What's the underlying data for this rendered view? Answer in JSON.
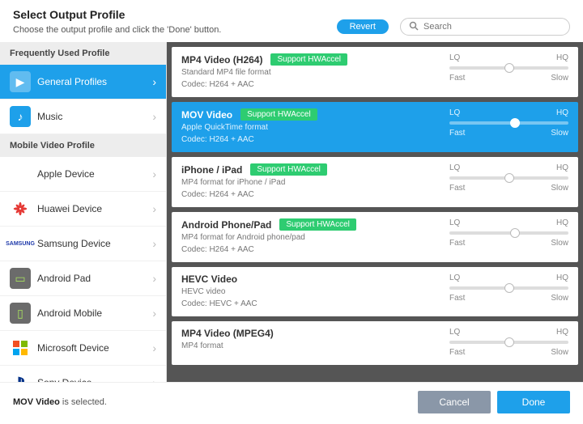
{
  "header": {
    "title": "Select Output Profile",
    "subtitle": "Choose the output profile and click the 'Done' button.",
    "revert": "Revert",
    "search_placeholder": "Search"
  },
  "sidebar": {
    "groups": [
      {
        "header": "Frequently Used Profile",
        "items": [
          {
            "label": "General Profiles",
            "icon": "play",
            "selected": true
          },
          {
            "label": "Music",
            "icon": "music"
          }
        ]
      },
      {
        "header": "Mobile Video Profile",
        "items": [
          {
            "label": "Apple Device",
            "icon": "apple"
          },
          {
            "label": "Huawei Device",
            "icon": "huawei"
          },
          {
            "label": "Samsung Device",
            "icon": "samsung"
          },
          {
            "label": "Android Pad",
            "icon": "tablet"
          },
          {
            "label": "Android Mobile",
            "icon": "phone"
          },
          {
            "label": "Microsoft Device",
            "icon": "ms"
          },
          {
            "label": "Sony Device",
            "icon": "sony"
          }
        ]
      }
    ]
  },
  "profiles": [
    {
      "title": "MP4 Video (H264)",
      "hw": "Support HWAccel",
      "desc": "Standard MP4 file format",
      "codec": "Codec: H264 + AAC",
      "slider": 50,
      "selected": false
    },
    {
      "title": "MOV Video",
      "hw": "Support HWAccel",
      "desc": "Apple QuickTime format",
      "codec": "Codec: H264 + AAC",
      "slider": 55,
      "selected": true
    },
    {
      "title": "iPhone / iPad",
      "hw": "Support HWAccel",
      "desc": "MP4 format for iPhone / iPad",
      "codec": "Codec: H264 + AAC",
      "slider": 50,
      "selected": false
    },
    {
      "title": "Android Phone/Pad",
      "hw": "Support HWAccel",
      "desc": "MP4 format for Android phone/pad",
      "codec": "Codec: H264 + AAC",
      "slider": 55,
      "selected": false
    },
    {
      "title": "HEVC Video",
      "hw": "",
      "desc": "HEVC video",
      "codec": "Codec: HEVC + AAC",
      "slider": 50,
      "selected": false
    },
    {
      "title": "MP4 Video (MPEG4)",
      "hw": "",
      "desc": "MP4 format",
      "codec": "",
      "slider": 50,
      "selected": false
    }
  ],
  "slider_labels": {
    "lq": "LQ",
    "hq": "HQ",
    "fast": "Fast",
    "slow": "Slow"
  },
  "footer": {
    "selected_name": "MOV Video",
    "selected_suffix": " is selected.",
    "cancel": "Cancel",
    "done": "Done"
  }
}
